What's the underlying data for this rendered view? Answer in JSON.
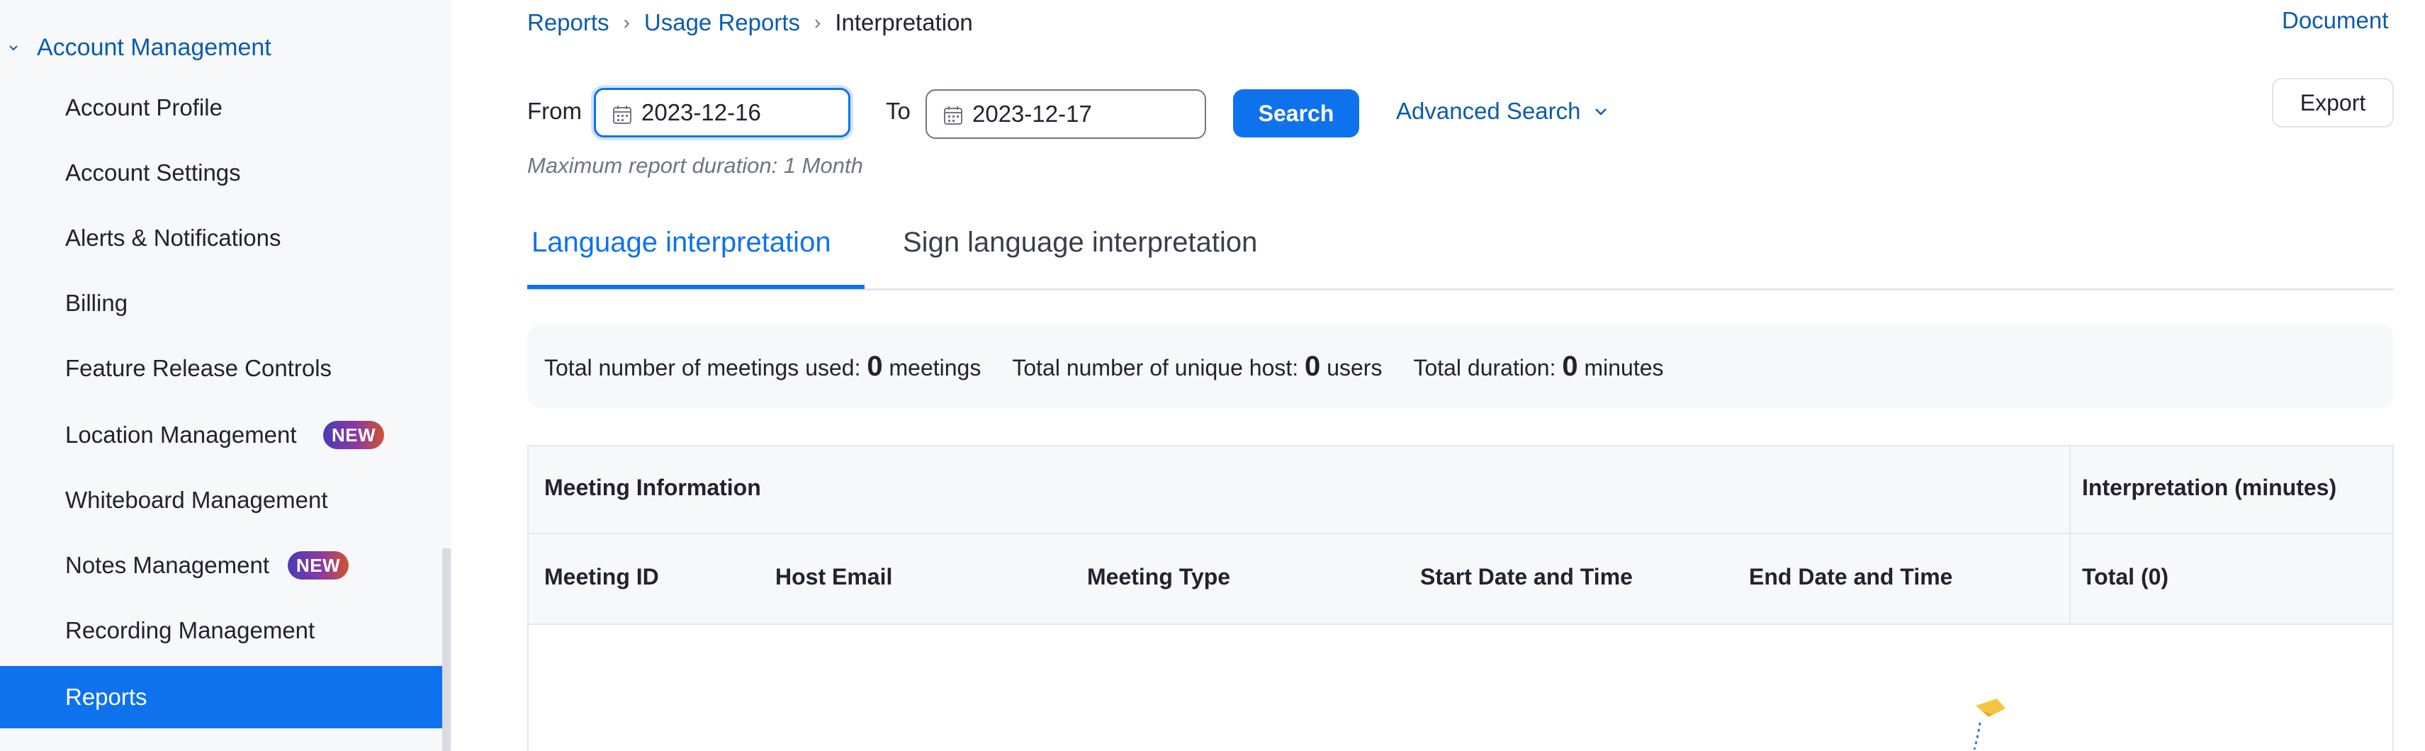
{
  "sidebar": {
    "group_label": "Account Management",
    "items": [
      {
        "label": "Account Profile"
      },
      {
        "label": "Account Settings"
      },
      {
        "label": "Alerts & Notifications"
      },
      {
        "label": "Billing"
      },
      {
        "label": "Feature Release Controls"
      },
      {
        "label": "Location Management",
        "badge": "NEW"
      },
      {
        "label": "Whiteboard Management"
      },
      {
        "label": "Notes Management",
        "badge": "NEW"
      },
      {
        "label": "Recording Management"
      },
      {
        "label": "Reports",
        "active": true
      }
    ]
  },
  "breadcrumb": [
    "Reports",
    "Usage Reports",
    "Interpretation"
  ],
  "header": {
    "document_link": "Document"
  },
  "filters": {
    "from_label": "From",
    "from_value": "2023-12-16",
    "to_label": "To",
    "to_value": "2023-12-17",
    "search_label": "Search",
    "advanced_search_label": "Advanced Search",
    "export_label": "Export",
    "max_note": "Maximum report duration: 1 Month"
  },
  "tabs": [
    {
      "label": "Language interpretation",
      "active": true
    },
    {
      "label": "Sign language interpretation",
      "active": false
    }
  ],
  "summary": {
    "meetings_label": "Total number of meetings used:",
    "meetings_value": "0",
    "meetings_unit": "meetings",
    "hosts_label": "Total number of unique host:",
    "hosts_value": "0",
    "hosts_unit": "users",
    "duration_label": "Total duration:",
    "duration_value": "0",
    "duration_unit": "minutes"
  },
  "table": {
    "group_headers": [
      "Meeting Information",
      "Interpretation (minutes)"
    ],
    "columns": [
      "Meeting ID",
      "Host Email",
      "Meeting Type",
      "Start Date and Time",
      "End Date and Time",
      "Total (0)"
    ]
  },
  "colors": {
    "accent": "#0e72ed",
    "link": "#0b5cad",
    "sidebar_bg": "#f7f8fa"
  }
}
